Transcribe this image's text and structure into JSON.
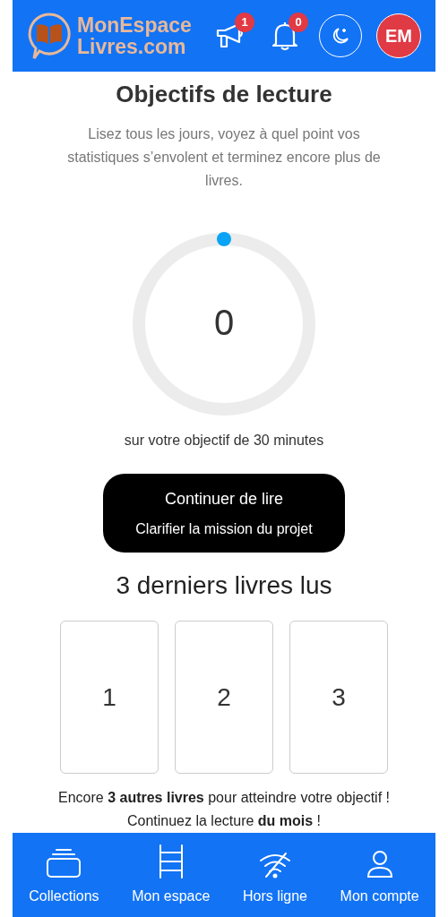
{
  "header": {
    "logo_lines": [
      "MonEspace",
      "Livres.com"
    ],
    "announcements_badge": "1",
    "notifications_badge": "0",
    "avatar": "EM"
  },
  "goal": {
    "title": "Objectifs de lecture",
    "description": "Lisez tous les jours, voyez à quel point vos statistiques s’envolent et terminez encore plus de livres.",
    "value": "0",
    "level": 0,
    "caption": "sur votre objectif de 30 minutes"
  },
  "continue_button": {
    "label": "Continuer de lire",
    "subtitle": "Clarifier la mission du projet"
  },
  "recent": {
    "title": "3 derniers livres lus",
    "books": [
      "1",
      "2",
      "3"
    ]
  },
  "footer_lines": [
    "Encore **3 autres livres** pour atteindre votre objectif !",
    "Continuez la lecture **du mois** !"
  ],
  "nav": [
    {
      "kind": "collections",
      "label": "Collections"
    },
    {
      "kind": "space",
      "label": "Mon espace"
    },
    {
      "kind": "offline",
      "label": "Hors ligne"
    },
    {
      "kind": "account",
      "label": "Mon compte"
    }
  ]
}
